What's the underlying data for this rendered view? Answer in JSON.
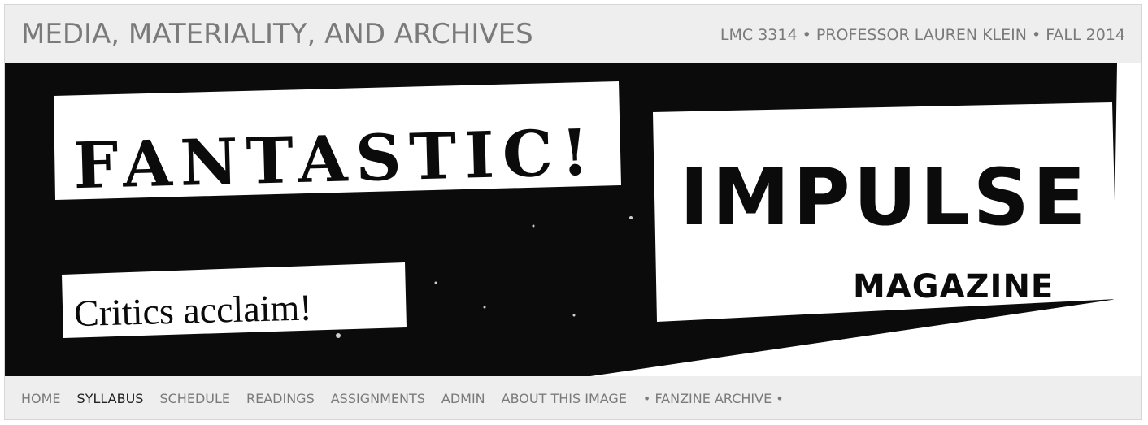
{
  "header": {
    "title": "MEDIA, MATERIALITY, AND ARCHIVES",
    "meta": "LMC 3314 • PROFESSOR LAUREN KLEIN • FALL 2014"
  },
  "banner": {
    "fantastic": "FANTASTIC!",
    "impulse": "IMPULSE",
    "magazine": "MAGAZINE",
    "critics": "Critics  acclaim!"
  },
  "nav": {
    "items": [
      {
        "label": "HOME",
        "active": false
      },
      {
        "label": "SYLLABUS",
        "active": true
      },
      {
        "label": "SCHEDULE",
        "active": false
      },
      {
        "label": "READINGS",
        "active": false
      },
      {
        "label": "ASSIGNMENTS",
        "active": false
      },
      {
        "label": "ADMIN",
        "active": false
      },
      {
        "label": "ABOUT THIS IMAGE",
        "active": false
      },
      {
        "label": "• FANZINE ARCHIVE •",
        "active": false
      }
    ]
  },
  "colors": {
    "frame_bg": "#eeeeee",
    "text_muted": "#7a7a7a",
    "text_active": "#222222",
    "banner_black": "#0b0b0b"
  }
}
